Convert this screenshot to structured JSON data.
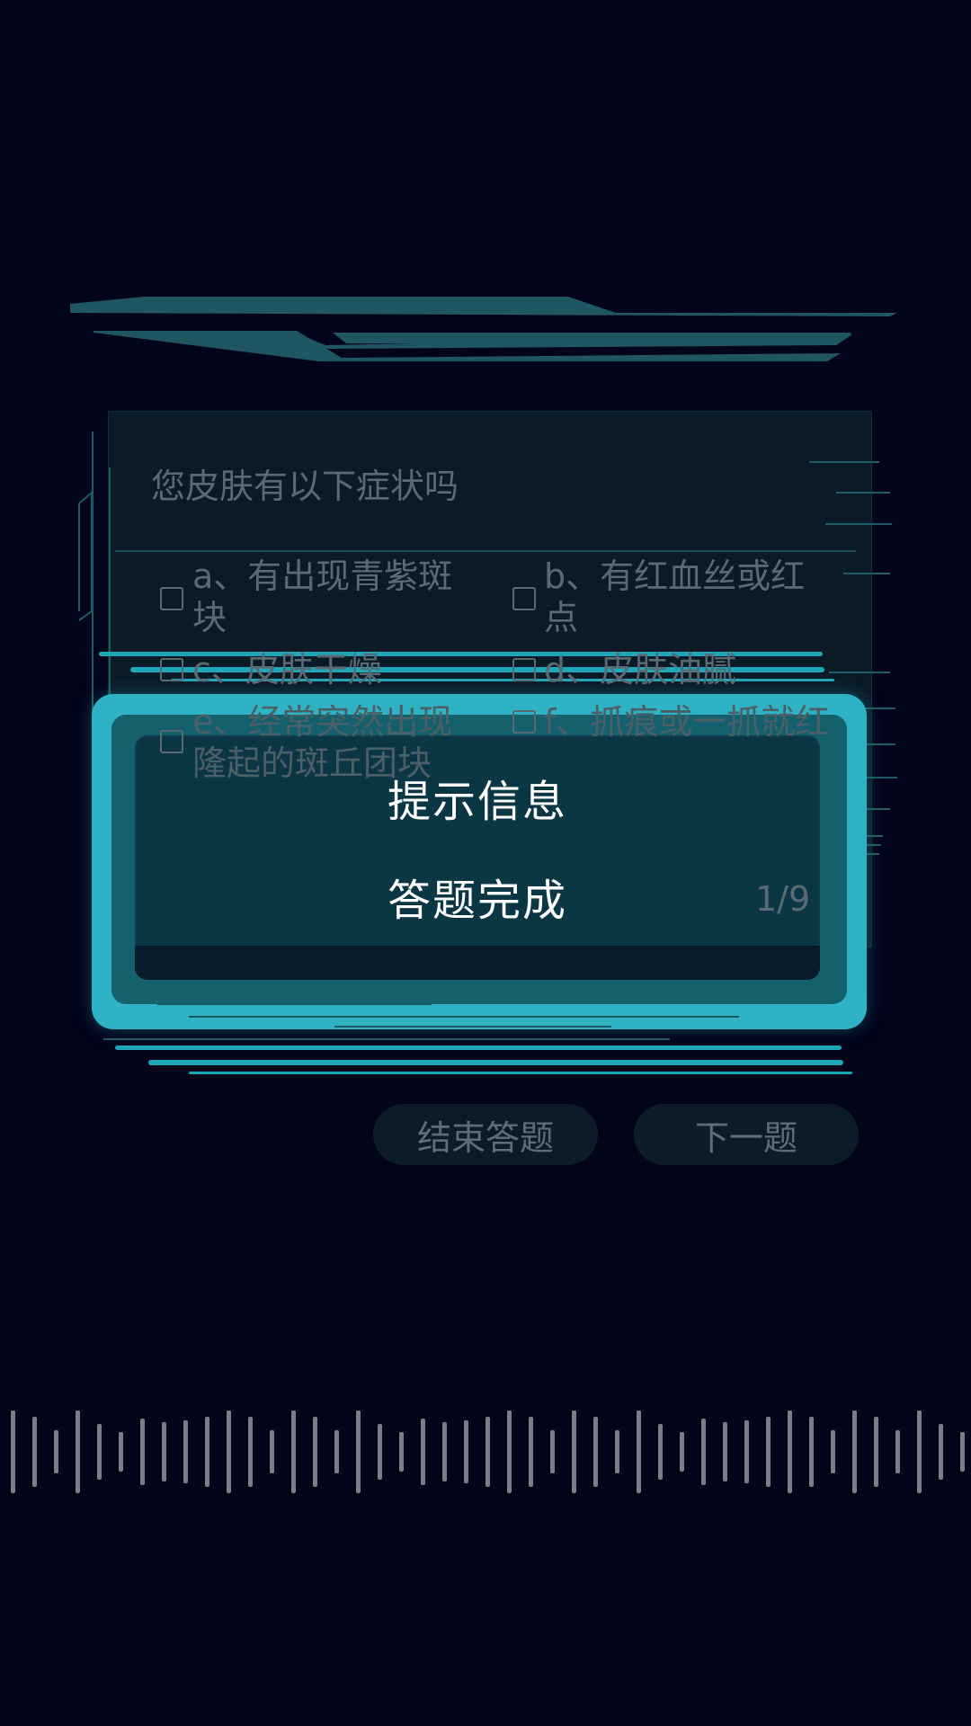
{
  "question": {
    "text": "您皮肤有以下症状吗",
    "options": [
      {
        "line1": "a、有出现青紫斑",
        "line2": "块"
      },
      {
        "line1": "b、有红血丝或红",
        "line2": "点"
      },
      {
        "line1": "c、皮肤干燥",
        "line2": ""
      },
      {
        "line1": "d、皮肤油腻",
        "line2": ""
      },
      {
        "line1": "e、经常突然出现",
        "line2": "隆起的斑丘团块"
      },
      {
        "line1": "f、抓痕或一抓就红",
        "line2": ""
      }
    ]
  },
  "modal": {
    "title": "提示信息",
    "message": "答题完成"
  },
  "progress": "1/9",
  "buttons": {
    "end_label": "结束答题",
    "next_label": "下一题"
  },
  "colors": {
    "background": "#02041a",
    "accent": "#2fb3c4",
    "muted_text": "#5a6a72"
  }
}
